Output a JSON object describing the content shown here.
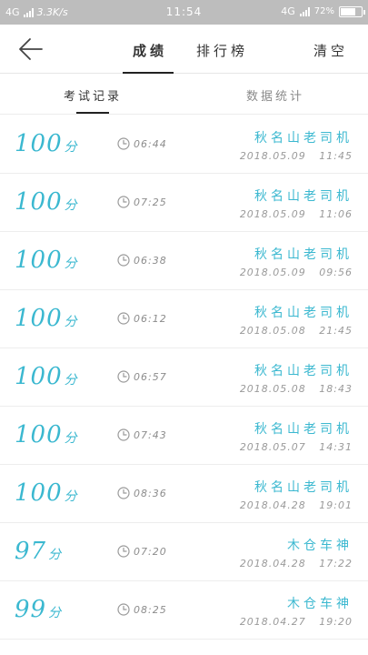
{
  "status_bar": {
    "network_left": "4G",
    "speed": "3.3K/s",
    "time": "11:54",
    "network_right": "4G",
    "battery": "72%",
    "battery_level": 0.72
  },
  "nav": {
    "tab_scores": "成绩",
    "tab_ranking": "排行榜",
    "clear": "清空"
  },
  "sub_tabs": {
    "records": "考试记录",
    "stats": "数据统计"
  },
  "records": [
    {
      "score": "100",
      "unit": "分",
      "duration": "06:44",
      "name": "秋名山老司机",
      "date": "2018.05.09 11:45"
    },
    {
      "score": "100",
      "unit": "分",
      "duration": "07:25",
      "name": "秋名山老司机",
      "date": "2018.05.09 11:06"
    },
    {
      "score": "100",
      "unit": "分",
      "duration": "06:38",
      "name": "秋名山老司机",
      "date": "2018.05.09 09:56"
    },
    {
      "score": "100",
      "unit": "分",
      "duration": "06:12",
      "name": "秋名山老司机",
      "date": "2018.05.08 21:45"
    },
    {
      "score": "100",
      "unit": "分",
      "duration": "06:57",
      "name": "秋名山老司机",
      "date": "2018.05.08 18:43"
    },
    {
      "score": "100",
      "unit": "分",
      "duration": "07:43",
      "name": "秋名山老司机",
      "date": "2018.05.07 14:31"
    },
    {
      "score": "100",
      "unit": "分",
      "duration": "08:36",
      "name": "秋名山老司机",
      "date": "2018.04.28 19:01"
    },
    {
      "score": "97",
      "unit": "分",
      "duration": "07:20",
      "name": "木仓车神",
      "date": "2018.04.28 17:22"
    },
    {
      "score": "99",
      "unit": "分",
      "duration": "08:25",
      "name": "木仓车神",
      "date": "2018.04.27 19:20"
    }
  ],
  "colors": {
    "accent": "#3bb8d0",
    "status_bar": "#bdbdbd"
  },
  "icons": {
    "back": "arrow-left-icon",
    "duration": "clock-icon",
    "signal": "signal-icon",
    "battery": "battery-icon"
  }
}
